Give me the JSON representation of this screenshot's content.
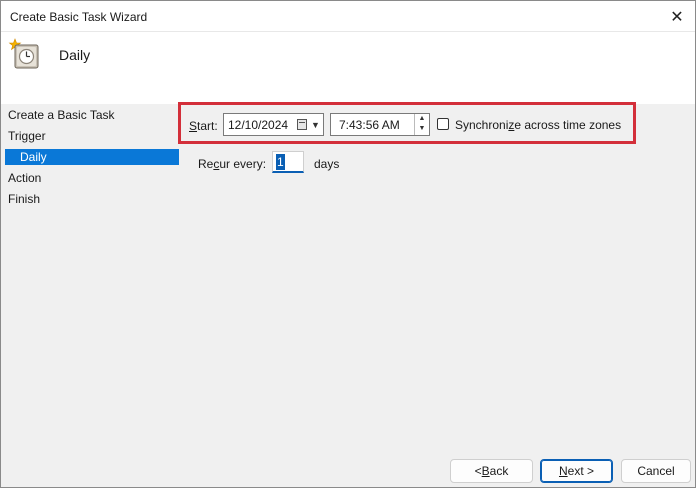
{
  "window": {
    "title": "Create Basic Task Wizard",
    "close_glyph": "✕"
  },
  "header": {
    "title": "Daily",
    "icon": "clock-icon"
  },
  "nav": {
    "items": [
      {
        "label": "Create a Basic Task",
        "selected": false
      },
      {
        "label": "Trigger",
        "selected": false
      },
      {
        "label": "Daily",
        "selected": true
      },
      {
        "label": "Action",
        "selected": false
      },
      {
        "label": "Finish",
        "selected": false
      }
    ]
  },
  "start": {
    "label_accel": "S",
    "label_rest": "tart:",
    "date": "12/10/2024",
    "time": "7:43:56 AM",
    "sync_label_pre": "Synchroni",
    "sync_label_accel": "z",
    "sync_label_post": "e across time zones",
    "sync_checked": false
  },
  "recur": {
    "label_pre": "Re",
    "label_accel": "c",
    "label_post": "ur every:",
    "value": "1",
    "unit": "days"
  },
  "buttons": {
    "back_prefix": "< ",
    "back_accel": "B",
    "back_rest": "ack",
    "next_accel": "N",
    "next_rest": "ext >",
    "cancel": "Cancel"
  },
  "colors": {
    "selection": "#0a78d7",
    "highlight_box": "#d32f3a",
    "focus": "#0a5fb4"
  }
}
